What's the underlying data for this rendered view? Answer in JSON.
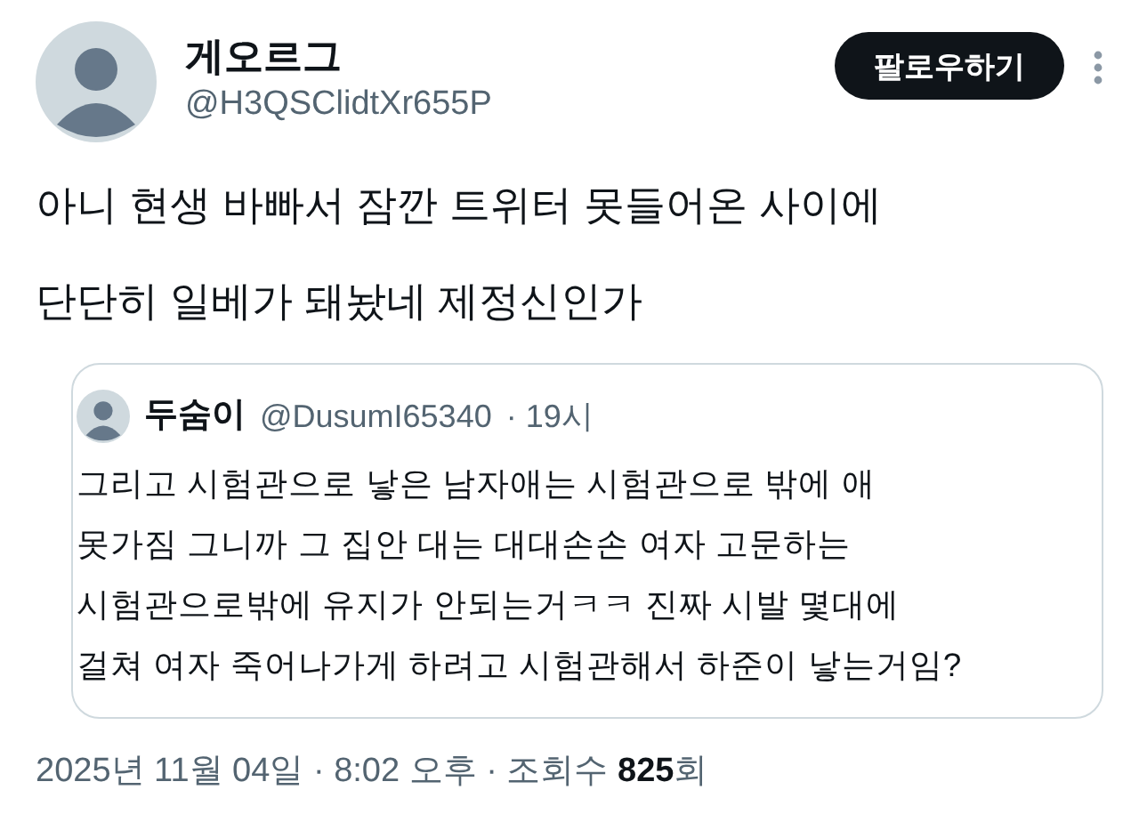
{
  "author": {
    "name": "게오르그",
    "handle": "@H3QSClidtXr655P"
  },
  "follow_button": "팔로우하기",
  "text": "아니 현생 바빠서 잠깐 트위터 못들어온 사이에\n단단히 일베가 돼놨네 제정신인가",
  "quote": {
    "name": "두숨이",
    "handle": "@DusumI65340",
    "time": "· 19시",
    "text": "그리고 시험관으로 낳은 남자애는 시험관으로 밖에 애\n못가짐 그니까 그 집안 대는 대대손손 여자 고문하는\n시험관으로밖에 유지가 안되는거ㅋㅋ 진짜 시발 몇대에\n걸쳐 여자 죽어나가게 하려고 시험관해서 하준이 낳는거임?"
  },
  "meta": "2025년 11월 04일 · 8:02 오후 · 조회수 **825**회"
}
